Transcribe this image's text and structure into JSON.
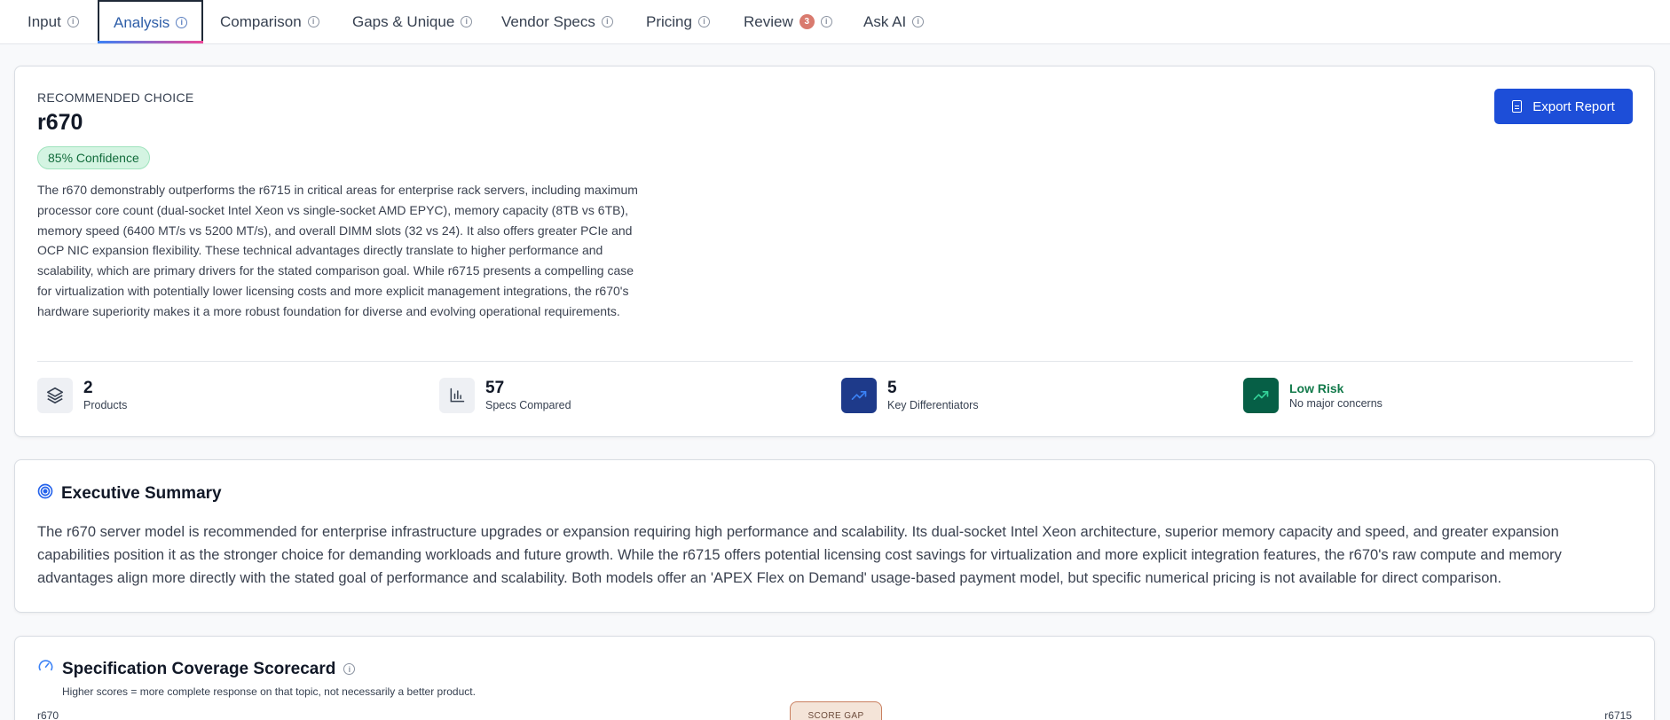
{
  "tabs": [
    {
      "label": "Input"
    },
    {
      "label": "Analysis"
    },
    {
      "label": "Comparison"
    },
    {
      "label": "Gaps & Unique"
    },
    {
      "label": "Vendor Specs"
    },
    {
      "label": "Pricing"
    },
    {
      "label": "Review",
      "badge": "3"
    },
    {
      "label": "Ask AI"
    }
  ],
  "recommendation": {
    "label": "RECOMMENDED CHOICE",
    "product": "r670",
    "confidence": "85% Confidence",
    "export_label": "Export Report",
    "description": "The r670 demonstrably outperforms the r6715 in critical areas for enterprise rack servers, including maximum processor core count (dual-socket Intel Xeon vs single-socket AMD EPYC), memory capacity (8TB vs 6TB), memory speed (6400 MT/s vs 5200 MT/s), and overall DIMM slots (32 vs 24). It also offers greater PCIe and OCP NIC expansion flexibility. These technical advantages directly translate to higher performance and scalability, which are primary drivers for the stated comparison goal. While r6715 presents a compelling case for virtualization with potentially lower licensing costs and more explicit management integrations, the r670's hardware superiority makes it a more robust foundation for diverse and evolving operational requirements."
  },
  "stats": {
    "products": {
      "value": "2",
      "label": "Products",
      "icon": "layers-icon",
      "icon_bg": "#eef0f4"
    },
    "specs": {
      "value": "57",
      "label": "Specs Compared",
      "icon": "bar-chart-icon",
      "icon_bg": "#eef0f4"
    },
    "differentiators": {
      "value": "5",
      "label": "Key Differentiators",
      "icon": "trend-up-icon",
      "icon_bg": "#1e3a8a"
    },
    "risk": {
      "title": "Low Risk",
      "subtitle": "No major concerns",
      "icon": "trend-up-icon",
      "icon_bg": "#065f46"
    }
  },
  "executive_summary": {
    "title": "Executive Summary",
    "text": "The r670 server model is recommended for enterprise infrastructure upgrades or expansion requiring high performance and scalability. Its dual-socket Intel Xeon architecture, superior memory capacity and speed, and greater expansion capabilities position it as the stronger choice for demanding workloads and future growth. While the r6715 offers potential licensing cost savings for virtualization and more explicit integration features, the r670's raw compute and memory advantages align more directly with the stated goal of performance and scalability. Both models offer an 'APEX Flex on Demand' usage-based payment model, but specific numerical pricing is not available for direct comparison."
  },
  "scorecard": {
    "title": "Specification Coverage Scorecard",
    "subtitle": "Higher scores = more complete response on that topic, not necessarily a better product.",
    "left_product": "r670",
    "gap_label": "SCORE GAP",
    "right_product": "r6715"
  },
  "colors": {
    "accent": "#1d4ed8",
    "confidence_bg": "#d4f4e2",
    "risk_text": "#137a4b"
  }
}
